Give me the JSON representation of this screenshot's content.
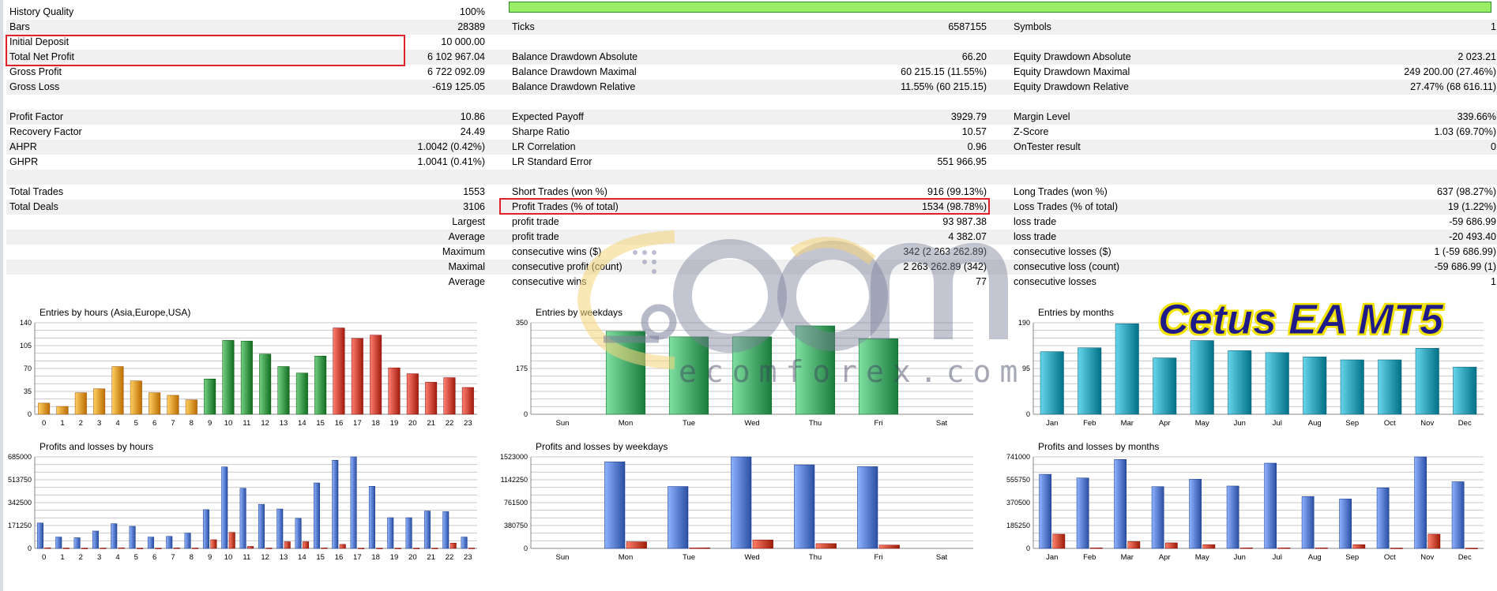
{
  "rows": [
    {
      "l1": "History Quality",
      "v1": "100%",
      "l2": "",
      "v2": "",
      "l3": "",
      "v3": ""
    },
    {
      "l1": "Bars",
      "v1": "28389",
      "l2": "Ticks",
      "v2": "6587155",
      "l3": "Symbols",
      "v3": "1"
    },
    {
      "l1": "Initial Deposit",
      "v1": "10 000.00",
      "l2": "",
      "v2": "",
      "l3": "",
      "v3": ""
    },
    {
      "l1": "Total Net Profit",
      "v1": "6 102 967.04",
      "l2": "Balance Drawdown Absolute",
      "v2": "66.20",
      "l3": "Equity Drawdown Absolute",
      "v3": "2 023.21"
    },
    {
      "l1": "Gross Profit",
      "v1": "6 722 092.09",
      "l2": "Balance Drawdown Maximal",
      "v2": "60 215.15 (11.55%)",
      "l3": "Equity Drawdown Maximal",
      "v3": "249 200.00 (27.46%)"
    },
    {
      "l1": "Gross Loss",
      "v1": "-619 125.05",
      "l2": "Balance Drawdown Relative",
      "v2": "11.55% (60 215.15)",
      "l3": "Equity Drawdown Relative",
      "v3": "27.47% (68 616.11)"
    },
    {
      "l1": "",
      "v1": "",
      "l2": "",
      "v2": "",
      "l3": "",
      "v3": ""
    },
    {
      "l1": "Profit Factor",
      "v1": "10.86",
      "l2": "Expected Payoff",
      "v2": "3929.79",
      "l3": "Margin Level",
      "v3": "339.66%"
    },
    {
      "l1": "Recovery Factor",
      "v1": "24.49",
      "l2": "Sharpe Ratio",
      "v2": "10.57",
      "l3": "Z-Score",
      "v3": "1.03 (69.70%)"
    },
    {
      "l1": "AHPR",
      "v1": "1.0042 (0.42%)",
      "l2": "LR Correlation",
      "v2": "0.96",
      "l3": "OnTester result",
      "v3": "0"
    },
    {
      "l1": "GHPR",
      "v1": "1.0041 (0.41%)",
      "l2": "LR Standard Error",
      "v2": "551 966.95",
      "l3": "",
      "v3": ""
    },
    {
      "l1": "",
      "v1": "",
      "l2": "",
      "v2": "",
      "l3": "",
      "v3": ""
    },
    {
      "l1": "Total Trades",
      "v1": "1553",
      "l2": "Short Trades (won %)",
      "v2": "916 (99.13%)",
      "l3": "Long Trades (won %)",
      "v3": "637 (98.27%)"
    },
    {
      "l1": "Total Deals",
      "v1": "3106",
      "l2": "Profit Trades (% of total)",
      "v2": "1534 (98.78%)",
      "l3": "Loss Trades (% of total)",
      "v3": "19 (1.22%)"
    },
    {
      "l1": "",
      "v1": "Largest",
      "l2": "profit trade",
      "v2": "93 987.38",
      "l3": "loss trade",
      "v3": "-59 686.99"
    },
    {
      "l1": "",
      "v1": "Average",
      "l2": "profit trade",
      "v2": "4 382.07",
      "l3": "loss trade",
      "v3": "-20 493.40"
    },
    {
      "l1": "",
      "v1": "Maximum",
      "l2": "consecutive wins ($)",
      "v2": "342 (2 263 262.89)",
      "l3": "consecutive losses ($)",
      "v3": "1 (-59 686.99)"
    },
    {
      "l1": "",
      "v1": "Maximal",
      "l2": "consecutive profit (count)",
      "v2": "2 263 262.89 (342)",
      "l3": "consecutive loss (count)",
      "v3": "-59 686.99 (1)"
    },
    {
      "l1": "",
      "v1": "Average",
      "l2": "consecutive wins",
      "v2": "77",
      "l3": "consecutive losses",
      "v3": "1"
    }
  ],
  "colors": {
    "highlight": "#e0202a",
    "quality_bar": "#99ee66",
    "grid": "#c8c8c8",
    "orange": "#d98a1e",
    "green": "#2e8b3e",
    "red": "#c0392b",
    "weekday_green": "#3a9a5c",
    "teal": "#1f8fa6",
    "blue": "#3f63b8",
    "loss_red": "#b0301a"
  },
  "watermark": {
    "brand_text": "ecomforex.com",
    "product_text": "Cetus EA MT5"
  },
  "chart_data": [
    {
      "type": "bar",
      "title": "Entries by hours (Asia,Europe,USA)",
      "categories": [
        "0",
        "1",
        "2",
        "3",
        "4",
        "5",
        "6",
        "7",
        "8",
        "9",
        "10",
        "11",
        "12",
        "13",
        "14",
        "15",
        "16",
        "17",
        "18",
        "19",
        "20",
        "21",
        "22",
        "23"
      ],
      "ylim": [
        0,
        140
      ],
      "yticks": [
        "0",
        "35",
        "70",
        "105",
        "140"
      ],
      "values": [
        17,
        12,
        33,
        39,
        73,
        51,
        33,
        29,
        22,
        54,
        113,
        112,
        92,
        73,
        63,
        89,
        132,
        116,
        121,
        71,
        62,
        49,
        56,
        41
      ]
    },
    {
      "type": "bar",
      "title": "Entries by weekdays",
      "categories": [
        "Sun",
        "Mon",
        "Tue",
        "Wed",
        "Thu",
        "Fri",
        "Sat"
      ],
      "ylim": [
        0,
        350
      ],
      "yticks": [
        "0",
        "175",
        "350"
      ],
      "values": [
        0,
        317,
        296,
        296,
        338,
        289,
        0
      ]
    },
    {
      "type": "bar",
      "title": "Entries by months",
      "categories": [
        "Jan",
        "Feb",
        "Mar",
        "Apr",
        "May",
        "Jun",
        "Jul",
        "Aug",
        "Sep",
        "Oct",
        "Nov",
        "Dec"
      ],
      "ylim": [
        0,
        190
      ],
      "yticks": [
        "0",
        "95",
        "190"
      ],
      "values": [
        130,
        138,
        188,
        117,
        153,
        132,
        128,
        119,
        113,
        113,
        137,
        98
      ]
    },
    {
      "type": "bar",
      "title": "Profits and losses by hours",
      "categories": [
        "0",
        "1",
        "2",
        "3",
        "4",
        "5",
        "6",
        "7",
        "8",
        "9",
        "10",
        "11",
        "12",
        "13",
        "14",
        "15",
        "16",
        "17",
        "18",
        "19",
        "20",
        "21",
        "22",
        "23"
      ],
      "ylim": [
        0,
        685000
      ],
      "yticks": [
        "0",
        "171250",
        "342500",
        "513750",
        "685000"
      ],
      "series": [
        {
          "values": [
            190000,
            85000,
            80000,
            130000,
            185000,
            165000,
            85000,
            90000,
            115000,
            290000,
            610000,
            450000,
            330000,
            295000,
            225000,
            490000,
            660000,
            685000,
            465000,
            230000,
            230000,
            280000,
            275000,
            85000
          ]
        },
        {
          "values": [
            5000,
            3000,
            2000,
            3000,
            5000,
            2000,
            2000,
            4000,
            3000,
            65000,
            120000,
            15000,
            3000,
            50000,
            50000,
            4000,
            30000,
            2000,
            2000,
            2000,
            2000,
            2000,
            40000,
            3000
          ]
        }
      ]
    },
    {
      "type": "bar",
      "title": "Profits and losses by weekdays",
      "categories": [
        "Sun",
        "Mon",
        "Tue",
        "Wed",
        "Thu",
        "Fri",
        "Sat"
      ],
      "ylim": [
        0,
        1523000
      ],
      "yticks": [
        "0",
        "380750",
        "761500",
        "1142250",
        "1523000"
      ],
      "series": [
        {
          "values": [
            0,
            1440000,
            1030000,
            1523000,
            1390000,
            1360000,
            0
          ]
        },
        {
          "values": [
            0,
            110000,
            10000,
            140000,
            80000,
            55000,
            0
          ]
        }
      ]
    },
    {
      "type": "bar",
      "title": "Profits and losses by months",
      "categories": [
        "Jan",
        "Feb",
        "Mar",
        "Apr",
        "May",
        "Jun",
        "Jul",
        "Aug",
        "Sep",
        "Oct",
        "Nov",
        "Dec"
      ],
      "ylim": [
        0,
        741000
      ],
      "yticks": [
        "0",
        "185250",
        "370500",
        "555750",
        "741000"
      ],
      "series": [
        {
          "values": [
            600000,
            570000,
            720000,
            500000,
            560000,
            505000,
            690000,
            420000,
            400000,
            490000,
            741000,
            540000
          ]
        },
        {
          "values": [
            115000,
            5000,
            55000,
            45000,
            30000,
            5000,
            5000,
            5000,
            30000,
            3000,
            115000,
            2000
          ]
        }
      ]
    }
  ]
}
